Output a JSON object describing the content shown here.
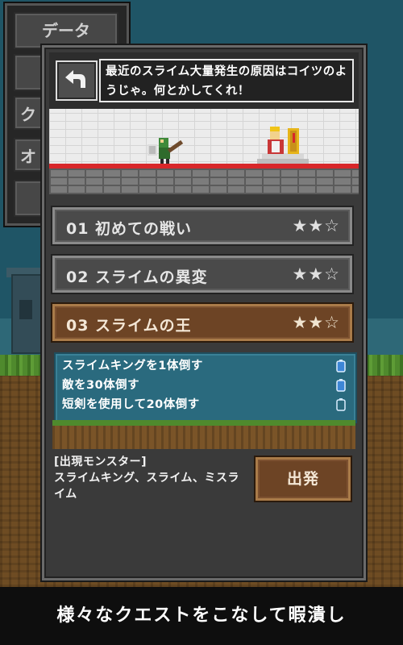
{
  "side_menu": {
    "items": [
      "データ",
      "",
      "ク",
      "オ",
      ""
    ]
  },
  "header": {
    "back_icon": "back-arrow-icon",
    "speech": "最近のスライム大量発生の原因はコイツのようじゃ。何とかしてくれ！"
  },
  "quests": [
    {
      "label": "01 初めての戦い",
      "stars": "★★☆",
      "rating": 2,
      "selected": false
    },
    {
      "label": "02 スライムの異変",
      "stars": "★★☆",
      "rating": 2,
      "selected": false
    },
    {
      "label": "03 スライムの王",
      "stars": "★★☆",
      "rating": 2,
      "selected": true
    }
  ],
  "conditions": [
    {
      "text": "スライムキングを1体倒す",
      "medal": "filled-medal-icon"
    },
    {
      "text": "敵を30体倒す",
      "medal": "filled-medal-icon"
    },
    {
      "text": "短剣を使用して20体倒す",
      "medal": "empty-medal-icon"
    }
  ],
  "monsters": {
    "title": "[出現モンスター]",
    "list": "スライムキング、スライム、ミスライム"
  },
  "depart_label": "出発",
  "caption": "様々なクエストをこなして暇潰し",
  "colors": {
    "selected_quest": "#6d4425",
    "conditions_bg": "#2a6a7e",
    "speech_border": "#e8e8e8",
    "red_line": "#d8272a"
  }
}
